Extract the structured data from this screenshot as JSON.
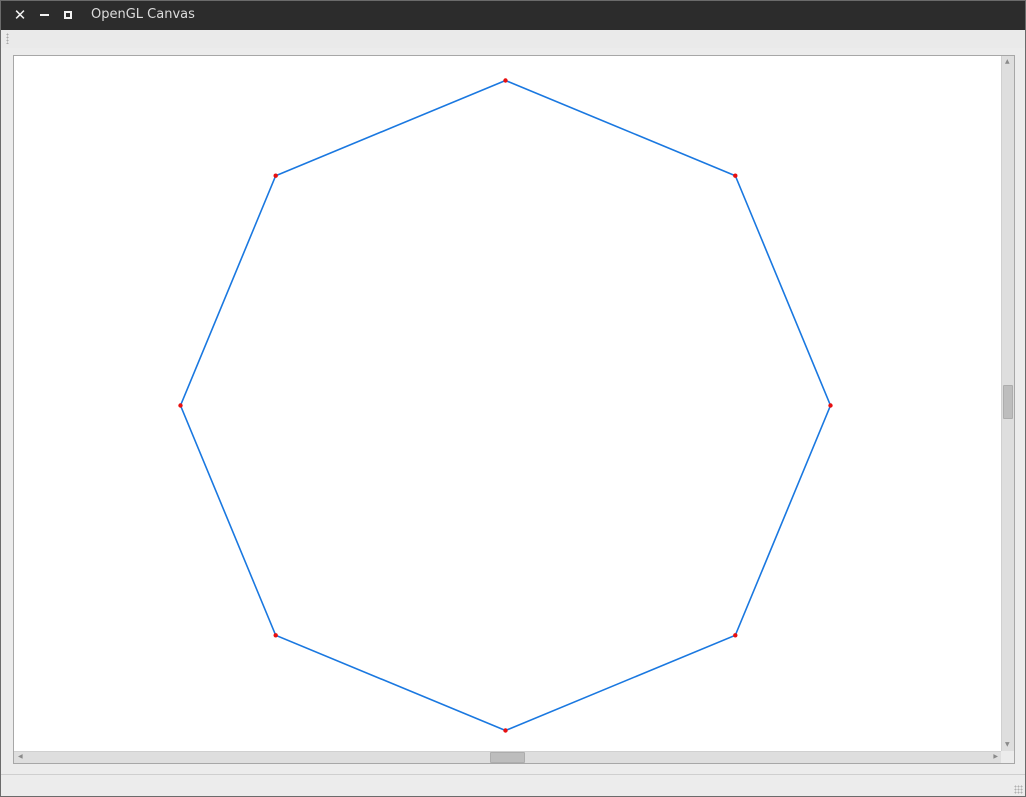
{
  "window": {
    "title": "OpenGL Canvas",
    "close_glyph": "✕"
  },
  "icons": {
    "close": "close-icon",
    "minimize": "minimize-icon",
    "maximize": "maximize-icon",
    "toolbar_grip": "grip-icon",
    "size_grip": "resize-grip-icon"
  },
  "colors": {
    "polygon_stroke": "#1a78e0",
    "vertex_fill": "#e81010",
    "canvas_background": "#ffffff",
    "titlebar_background": "#2c2c2c"
  },
  "canvas": {
    "shape": "octagon",
    "vertex_count": 8
  }
}
